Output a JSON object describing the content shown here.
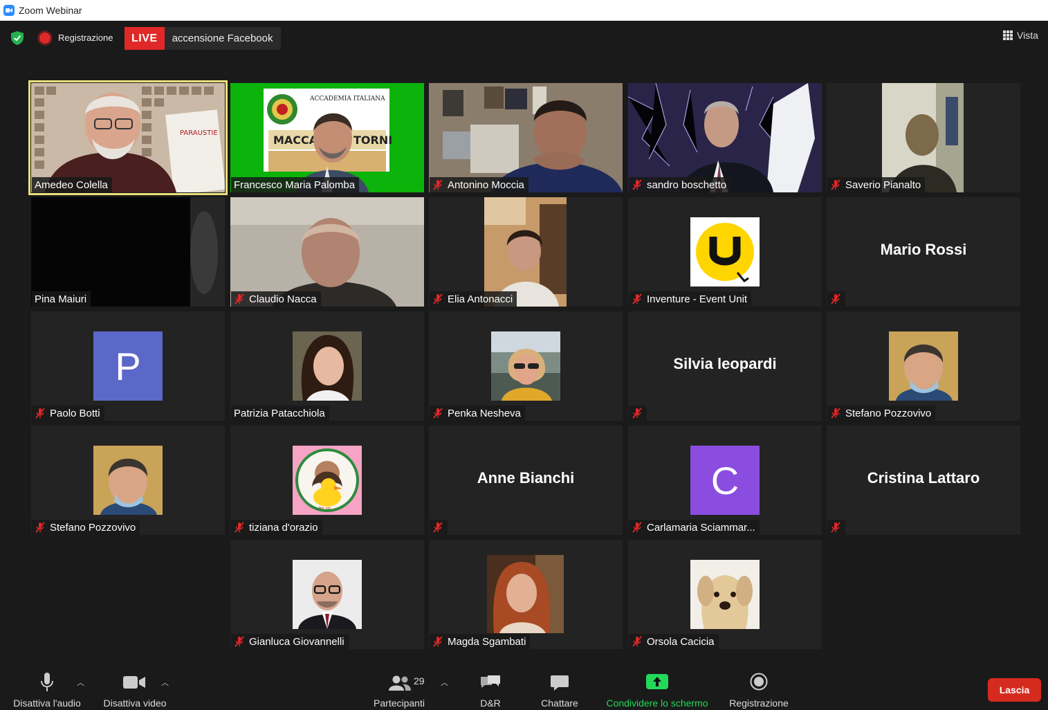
{
  "window": {
    "title": "Zoom Webinar"
  },
  "topbar": {
    "recording_label": "Registrazione",
    "live_badge": "LIVE",
    "live_text": "accensione Facebook",
    "view_label": "Vista"
  },
  "tiles": [
    {
      "name": "Amedeo Colella",
      "muted": false,
      "kind": "video",
      "active": true
    },
    {
      "name": "Francesco Maria Palomba",
      "muted": false,
      "kind": "video"
    },
    {
      "name": "Antonino Moccia",
      "muted": true,
      "kind": "video"
    },
    {
      "name": "sandro boschetto",
      "muted": true,
      "kind": "video"
    },
    {
      "name": "Saverio Pianalto",
      "muted": true,
      "kind": "video"
    },
    {
      "name": "Pina Maiuri",
      "muted": false,
      "kind": "video"
    },
    {
      "name": "Claudio Nacca",
      "muted": true,
      "kind": "video"
    },
    {
      "name": "Elia Antonacci",
      "muted": true,
      "kind": "video"
    },
    {
      "name": "Inventure - Event Unit",
      "muted": true,
      "kind": "logo",
      "logo_letter": "U",
      "logo_color": "#ffd500"
    },
    {
      "name": "",
      "muted": true,
      "kind": "name",
      "big_name": "Mario Rossi"
    },
    {
      "name": "Paolo Botti",
      "muted": true,
      "kind": "letter",
      "letter": "P",
      "letter_color": "#5c68c8"
    },
    {
      "name": "Patrizia Patacchiola",
      "muted": false,
      "kind": "photo"
    },
    {
      "name": "Penka Nesheva",
      "muted": true,
      "kind": "photo"
    },
    {
      "name": "",
      "muted": true,
      "kind": "name",
      "big_name": "Silvia leopardi"
    },
    {
      "name": "Stefano Pozzovivo",
      "muted": true,
      "kind": "photo"
    },
    {
      "name": "Stefano Pozzovivo",
      "muted": true,
      "kind": "photo"
    },
    {
      "name": "tiziana d'orazio",
      "muted": true,
      "kind": "photo"
    },
    {
      "name": "",
      "muted": true,
      "kind": "name",
      "big_name": "Anne Bianchi"
    },
    {
      "name": "Carlamaria Sciammar...",
      "muted": true,
      "kind": "letter",
      "letter": "C",
      "letter_color": "#8a4de0"
    },
    {
      "name": "",
      "muted": true,
      "kind": "name",
      "big_name": "Cristina Lattaro"
    },
    {
      "name": "Gianluca Giovannelli",
      "muted": true,
      "kind": "photo"
    },
    {
      "name": "Magda Sgambati",
      "muted": true,
      "kind": "photo"
    },
    {
      "name": "Orsola Cacicia",
      "muted": true,
      "kind": "photo"
    }
  ],
  "toolbar": {
    "audio_label": "Disattiva l'audio",
    "video_label": "Disattiva video",
    "participants_label": "Partecipanti",
    "participants_count": "29",
    "qa_label": "D&R",
    "chat_label": "Chattare",
    "share_label": "Condividere lo schermo",
    "record_label": "Registrazione",
    "leave_label": "Lascia"
  },
  "colors": {
    "accent_green": "#23d959",
    "leave_red": "#d52b1e",
    "active_speaker": "#e9e07b",
    "muted_red": "#e02828"
  }
}
